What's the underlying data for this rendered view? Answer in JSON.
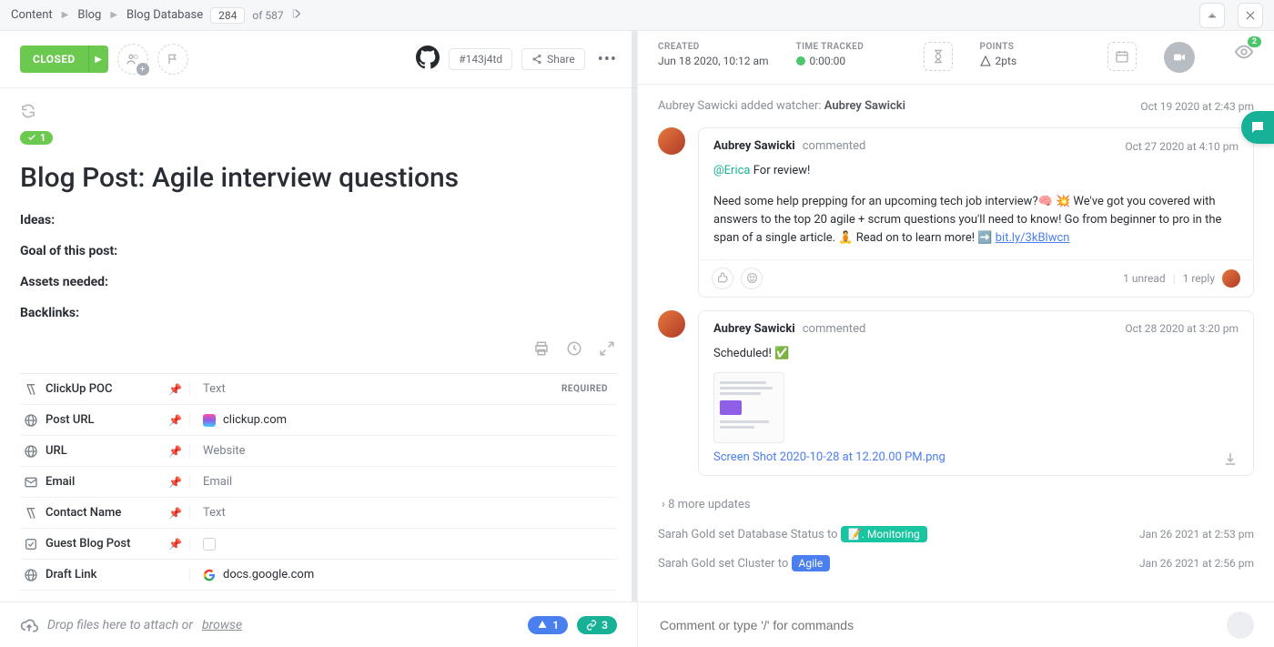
{
  "breadcrumb": {
    "seg1": "Content",
    "seg2": "Blog",
    "seg3": "Blog Database",
    "page": "284",
    "of": "of  587"
  },
  "left_header": {
    "status": "CLOSED",
    "task_id": "#143j4td",
    "share": "Share"
  },
  "subtask_count": "1",
  "title": "Blog Post: Agile interview questions",
  "desc": {
    "h1": "Ideas:",
    "h2": "Goal of this post:",
    "h3": "Assets needed:",
    "h4": "Backlinks:"
  },
  "fields": {
    "poc": {
      "label": "ClickUp POC",
      "ph": "Text",
      "required": "REQUIRED"
    },
    "posturl": {
      "label": "Post URL",
      "val": "clickup.com"
    },
    "url": {
      "label": "URL",
      "ph": "Website"
    },
    "email": {
      "label": "Email",
      "ph": "Email"
    },
    "contact": {
      "label": "Contact Name",
      "ph": "Text"
    },
    "guest": {
      "label": "Guest Blog Post"
    },
    "draft": {
      "label": "Draft Link",
      "val": "docs.google.com"
    }
  },
  "lfoot": {
    "text": "Drop files here to attach or ",
    "browse": "browse",
    "chip_drive": "1",
    "chip_link": "3"
  },
  "right_header": {
    "created_lbl": "CREATED",
    "created_val": "Jun 18 2020, 10:12 am",
    "tracked_lbl": "TIME TRACKED",
    "tracked_val": "0:00:00",
    "points_lbl": "POINTS",
    "points_val": "2pts",
    "eye_badge": "2"
  },
  "activity": {
    "watcher_line_pre": "Aubrey Sawicki added watcher: ",
    "watcher_name": "Aubrey Sawicki",
    "watcher_ts": "Oct 19 2020 at 2:43 pm",
    "c1_author": "Aubrey Sawicki",
    "c1_action": "commented",
    "c1_ts": "Oct 27 2020 at 4:10 pm",
    "c1_body_mention": "@Erica",
    "c1_body_after_mention": " For review!",
    "c1_body_para": "Need some help prepping for an upcoming tech job interview?🧠 💥 We've got you covered with answers to the top 20 agile + scrum questions you'll need to know! Go from beginner to pro in the span of a single article.  🧘 Read on to learn more! ➡️ ",
    "c1_link": "bit.ly/3kBlwcn",
    "c1_unread": "1 unread",
    "c1_reply": "1 reply",
    "c2_author": "Aubrey Sawicki",
    "c2_action": "commented",
    "c2_ts": "Oct 28 2020 at 3:20 pm",
    "c2_body": "Scheduled! ✅",
    "c2_attach_name": "Screen Shot 2020-10-28 at 12.20.00 PM.png",
    "more_updates": "8 more updates",
    "db_line_pre": "Sarah Gold set Database Status to ",
    "db_badge": "📝. Monitoring",
    "db_ts": "Jan 26 2021 at 2:53 pm",
    "cl_line_pre": "Sarah Gold set Cluster to ",
    "cl_badge": "Agile",
    "cl_ts": "Jan 26 2021 at 2:56 pm"
  },
  "rfoot": {
    "placeholder": "Comment or type '/' for commands"
  }
}
